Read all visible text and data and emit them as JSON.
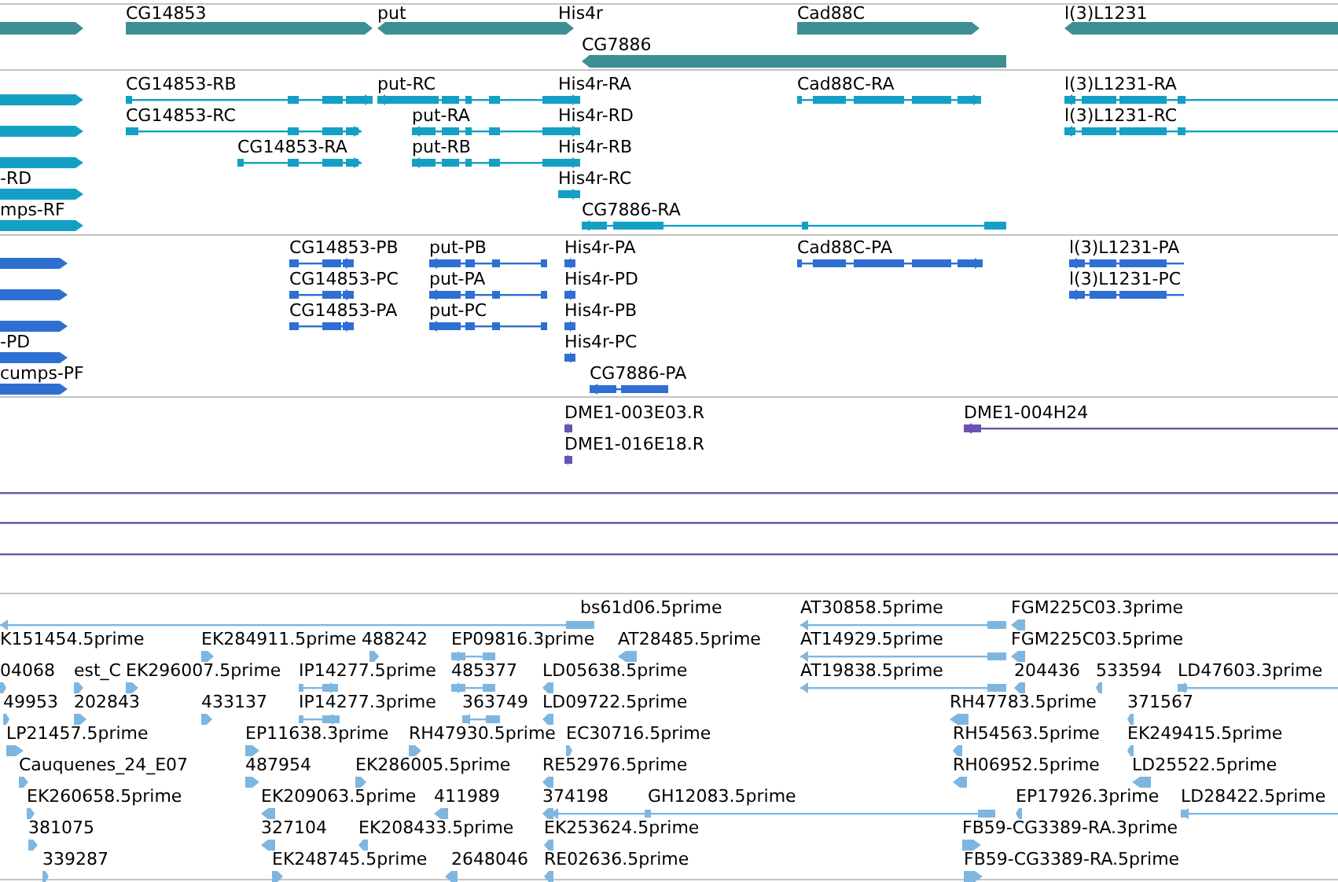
{
  "tracks": [
    {
      "kind": "gene",
      "features": [
        {
          "reverse": false
        },
        {
          "label": "CG14853",
          "reverse": false
        },
        {
          "label": "put",
          "reverse": true
        },
        {
          "label": "His4r",
          "reverse": false
        },
        {
          "label": "CG7886",
          "reverse": true
        },
        {
          "label": "Cad88C",
          "reverse": false
        },
        {
          "label": "l(3)L1231",
          "reverse": true
        }
      ]
    },
    {
      "kind": "transcript",
      "features": [
        {
          "reverse": false
        },
        {
          "reverse": false
        },
        {
          "reverse": false
        },
        {
          "label": "-RD",
          "reverse": false
        },
        {
          "label": "mps-RF",
          "reverse": false
        },
        {
          "label": "CG14853-RB",
          "reverse": false
        },
        {
          "label": "CG14853-RC",
          "reverse": false
        },
        {
          "label": "CG14853-RA",
          "reverse": false
        },
        {
          "label": "put-RC",
          "reverse": true
        },
        {
          "label": "put-RA",
          "reverse": true
        },
        {
          "label": "put-RB",
          "reverse": true
        },
        {
          "label": "His4r-RA",
          "reverse": false
        },
        {
          "label": "His4r-RD",
          "reverse": false
        },
        {
          "label": "His4r-RB",
          "reverse": false
        },
        {
          "label": "His4r-RC",
          "reverse": false
        },
        {
          "label": "CG7886-RA",
          "reverse": true
        },
        {
          "label": "Cad88C-RA",
          "reverse": false
        },
        {
          "label": "l(3)L1231-RA",
          "reverse": true
        },
        {
          "label": "l(3)L1231-RC",
          "reverse": true
        }
      ]
    },
    {
      "kind": "protein",
      "features": [
        {
          "reverse": false
        },
        {
          "reverse": false
        },
        {
          "reverse": false
        },
        {
          "label": "-PD",
          "reverse": false
        },
        {
          "label": "cumps-PF",
          "reverse": false
        },
        {
          "label": "CG14853-PB",
          "reverse": false
        },
        {
          "label": "CG14853-PC",
          "reverse": false
        },
        {
          "label": "CG14853-PA",
          "reverse": false
        },
        {
          "label": "put-PB",
          "reverse": true
        },
        {
          "label": "put-PA",
          "reverse": true
        },
        {
          "label": "put-PC",
          "reverse": true
        },
        {
          "label": "His4r-PA",
          "reverse": false
        },
        {
          "label": "His4r-PD",
          "reverse": false
        },
        {
          "label": "His4r-PB",
          "reverse": false
        },
        {
          "label": "His4r-PC",
          "reverse": false
        },
        {
          "label": "CG7886-PA",
          "reverse": true
        },
        {
          "label": "Cad88C-PA",
          "reverse": false
        },
        {
          "label": "l(3)L1231-PA",
          "reverse": true
        },
        {
          "label": "l(3)L1231-PC",
          "reverse": true
        }
      ]
    },
    {
      "kind": "clone",
      "features": [
        {
          "label": "DME1-003E03.R",
          "reverse": true
        },
        {
          "label": "DME1-016E18.R",
          "reverse": true
        },
        {
          "label": "DME1-004H24",
          "reverse": true
        },
        {
          "kind": "line"
        },
        {
          "kind": "line"
        },
        {
          "kind": "line"
        }
      ]
    },
    {
      "kind": "est",
      "features": [
        {
          "label": "bs61d06.5prime",
          "reverse": true
        },
        {
          "label": "AT30858.5prime",
          "reverse": true
        },
        {
          "label": "FGM225C03.3prime",
          "reverse": true
        },
        {
          "label": "K151454.5prime"
        },
        {
          "label": "EK284911.5prime",
          "reverse": false
        },
        {
          "label": "488242",
          "reverse": false
        },
        {
          "label": "EP09816.3prime",
          "reverse": true
        },
        {
          "label": "AT28485.5prime",
          "reverse": true
        },
        {
          "label": "AT14929.5prime",
          "reverse": true
        },
        {
          "label": "FGM225C03.5prime",
          "reverse": true
        },
        {
          "label": "04068",
          "reverse": false
        },
        {
          "label": "est_C",
          "reverse": false
        },
        {
          "label": "EK296007.5prime",
          "reverse": false
        },
        {
          "label": "IP14277.5prime",
          "reverse": false
        },
        {
          "label": "485377",
          "reverse": true
        },
        {
          "label": "LD05638.5prime",
          "reverse": true
        },
        {
          "label": "AT19838.5prime",
          "reverse": true
        },
        {
          "label": "204436",
          "reverse": true
        },
        {
          "label": "533594",
          "reverse": true
        },
        {
          "label": "LD47603.3prime",
          "reverse": true
        },
        {
          "label": "49953",
          "reverse": false
        },
        {
          "label": "202843",
          "reverse": false
        },
        {
          "label": "433137",
          "reverse": false
        },
        {
          "label": "IP14277.3prime",
          "reverse": false
        },
        {
          "label": "363749",
          "reverse": true
        },
        {
          "label": "LD09722.5prime",
          "reverse": true
        },
        {
          "label": "RH47783.5prime",
          "reverse": true
        },
        {
          "label": "371567",
          "reverse": true
        },
        {
          "label": "LP21457.5prime",
          "reverse": false
        },
        {
          "label": "EP11638.3prime",
          "reverse": false
        },
        {
          "label": "RH47930.5prime",
          "reverse": false
        },
        {
          "label": "EC30716.5prime",
          "reverse": false
        },
        {
          "label": "RH54563.5prime",
          "reverse": true
        },
        {
          "label": "EK249415.5prime",
          "reverse": true
        },
        {
          "label": "Cauquenes_24_E07",
          "reverse": false
        },
        {
          "label": "487954",
          "reverse": false
        },
        {
          "label": "EK286005.5prime",
          "reverse": false
        },
        {
          "label": "RE52976.5prime",
          "reverse": true
        },
        {
          "label": "RH06952.5prime",
          "reverse": true
        },
        {
          "label": "LD25522.5prime",
          "reverse": true
        },
        {
          "label": "EK260658.5prime",
          "reverse": false
        },
        {
          "label": "EK209063.5prime",
          "reverse": true
        },
        {
          "label": "411989",
          "reverse": true
        },
        {
          "label": "374198",
          "reverse": true
        },
        {
          "label": "GH12083.5prime",
          "reverse": true
        },
        {
          "label": "EP17926.3prime",
          "reverse": true
        },
        {
          "label": "LD28422.5prime",
          "reverse": true
        },
        {
          "label": "381075",
          "reverse": false
        },
        {
          "label": "327104",
          "reverse": true
        },
        {
          "label": "EK208433.5prime",
          "reverse": true
        },
        {
          "label": "EK253624.5prime",
          "reverse": true
        },
        {
          "label": "FB59-CG3389-RA.3prime",
          "reverse": false
        },
        {
          "label": "339287",
          "reverse": false
        },
        {
          "label": "EK248745.5prime",
          "reverse": false
        },
        {
          "label": "2648046",
          "reverse": true
        },
        {
          "label": "RE02636.5prime",
          "reverse": true
        },
        {
          "label": "FB59-CG3389-RA.5prime",
          "reverse": false
        }
      ]
    }
  ]
}
